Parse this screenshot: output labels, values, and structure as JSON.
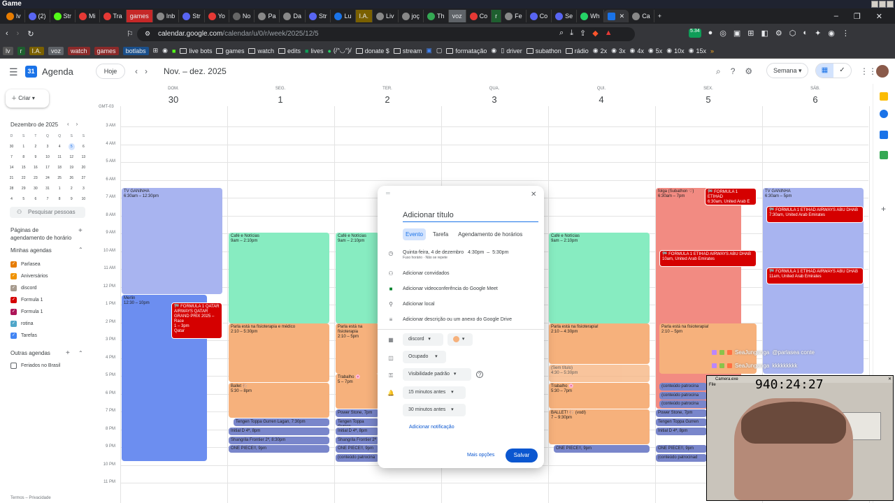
{
  "window": {
    "title": "Game"
  },
  "tabs": [
    "lv",
    "(2)",
    "Str",
    "Mi",
    "Tra",
    "games",
    "Inb",
    "Str",
    "Yo",
    "No",
    "Pa",
    "Da",
    "Str",
    "Lu",
    "I.A.",
    "Liv",
    "joç",
    "Th",
    "voz",
    "Co",
    "r",
    "Fe",
    "Co",
    "Se",
    "Wh",
    "",
    "Ca"
  ],
  "url": {
    "host": "calendar.google.com",
    "path": "/calendar/u/0/r/week/2025/12/5"
  },
  "extensions": {
    "badge": "5.34"
  },
  "bookmarks": [
    {
      "label": "lv",
      "chip": true
    },
    {
      "label": "r",
      "chip": true
    },
    {
      "label": "I.A.",
      "chip": true
    },
    {
      "label": "voz",
      "chip": true
    },
    {
      "label": "watch",
      "chip": true
    },
    {
      "label": "games",
      "chip": true
    },
    {
      "label": "botlabs",
      "chip": true
    },
    {
      "label": "live bots"
    },
    {
      "label": "games"
    },
    {
      "label": "watch"
    },
    {
      "label": "edits"
    },
    {
      "label": "lives"
    },
    {
      "label": "(/ᐢ◡ᐢ)/"
    },
    {
      "label": "donate $"
    },
    {
      "label": "stream"
    },
    {
      "label": "formatação"
    },
    {
      "label": "driver"
    },
    {
      "label": "subathon"
    },
    {
      "label": "rádio"
    },
    {
      "label": "2x"
    },
    {
      "label": "3x"
    },
    {
      "label": "4x"
    },
    {
      "label": "5x"
    },
    {
      "label": "10x"
    },
    {
      "label": "15x"
    }
  ],
  "header": {
    "app_name": "Agenda",
    "today": "Hoje",
    "range": "Nov. – dez. 2025",
    "view": "Semana",
    "logo_text": "31"
  },
  "sidebar": {
    "create": "Criar",
    "mini_month": "Dezembro de 2025",
    "weekdays": [
      "D",
      "S",
      "T",
      "Q",
      "Q",
      "S",
      "S"
    ],
    "weeks": [
      [
        "30",
        "1",
        "2",
        "3",
        "4",
        "5",
        "6"
      ],
      [
        "7",
        "8",
        "9",
        "10",
        "11",
        "12",
        "13"
      ],
      [
        "14",
        "15",
        "16",
        "17",
        "18",
        "19",
        "20"
      ],
      [
        "21",
        "22",
        "23",
        "24",
        "25",
        "26",
        "27"
      ],
      [
        "28",
        "29",
        "30",
        "31",
        "1",
        "2",
        "3"
      ],
      [
        "4",
        "5",
        "6",
        "7",
        "8",
        "9",
        "10"
      ]
    ],
    "search_people": "Pesquisar pessoas",
    "booking_pages": "Páginas de agendamento de horário",
    "my_calendars": "Minhas agendas",
    "calendars": [
      {
        "name": "Parlasea",
        "color": "#e67c00"
      },
      {
        "name": "Aniversários",
        "color": "#f09300"
      },
      {
        "name": "discord",
        "color": "#a79b8e"
      },
      {
        "name": "Formula 1",
        "color": "#d50000"
      },
      {
        "name": "Formula 1",
        "color": "#ad1457"
      },
      {
        "name": "rotina",
        "color": "#4fa6c9"
      },
      {
        "name": "Tarefas",
        "color": "#4285f4"
      }
    ],
    "other_calendars": "Outras agendas",
    "others": [
      {
        "name": "Feriados no Brasil"
      }
    ],
    "footer": "Termos – Privacidade"
  },
  "week": {
    "gmt": "GMT-03",
    "days": [
      {
        "name": "DOM.",
        "num": "30"
      },
      {
        "name": "SEG.",
        "num": "1"
      },
      {
        "name": "TER.",
        "num": "2"
      },
      {
        "name": "QUA.",
        "num": "3"
      },
      {
        "name": "QUI.",
        "num": "4"
      },
      {
        "name": "SEX.",
        "num": "5"
      },
      {
        "name": "SÁB.",
        "num": "6"
      }
    ],
    "hours": [
      "3 AM",
      "4 AM",
      "5 AM",
      "6 AM",
      "7 AM",
      "8 AM",
      "9 AM",
      "10 AM",
      "11 AM",
      "12 PM",
      "1 PM",
      "2 PM",
      "3 PM",
      "4 PM",
      "5 PM",
      "6 PM",
      "7 PM",
      "8 PM",
      "9 PM",
      "10 PM",
      "11 PM"
    ]
  },
  "events": {
    "e1": {
      "title": "TV GANINHA",
      "time": "6:30am – 12:30pm"
    },
    "e2": {
      "title": "Merlin",
      "time": "12:30 – 10pm"
    },
    "e3": {
      "title": "🏁 FORMULA 1 QATAR AIRWAYS QATAR GRAND PRIX 2025 – Race",
      "time": "1 – 3pm",
      "loc": "Qatar"
    },
    "e4": {
      "title": "Café e Notícias",
      "time": "9am – 2:10pm"
    },
    "e5": {
      "title": "Parla está na fisioterapia e médico",
      "time": "2:10 – 5:30pm"
    },
    "e6": {
      "title": "Ballet 🩰",
      "time": "5:30 – 8pm"
    },
    "e7": {
      "title": "Tengen Toppa Gurren Lagan, 7:30pm"
    },
    "e8": {
      "title": "Initial D 4ª, 8pm"
    },
    "e9": {
      "title": "Shangrila Frontier 2ª, 8:30pm"
    },
    "e10": {
      "title": "ONE PIECE!!, 9pm"
    },
    "e11": {
      "title": "Café e Notícias",
      "time": "9am – 2:10pm"
    },
    "e12": {
      "title": "Parla está na fisioterapia",
      "time": "2:10 – 5pm"
    },
    "e13": {
      "title": "Trabalho 🌸",
      "time": "5 – 7pm"
    },
    "e14": {
      "title": "Power Stone, 7pm"
    },
    "e15": {
      "title": "Tengen Toppa Gurren"
    },
    "e16": {
      "title": "Initial D 4ª, 8pm"
    },
    "e17": {
      "title": "Shangrila Frontier 2ª"
    },
    "e18": {
      "title": "ONE PIECE!!, 9pm"
    },
    "e19": {
      "title": "(conteúdo patrocina"
    },
    "e20": {
      "title": "Café e Notícias",
      "time": "9am – 2:10pm"
    },
    "e21": {
      "title": "Parla está na fisioterapia!",
      "time": "2:10 – 4:30pm"
    },
    "e22": {
      "title": "(Sem título)",
      "time": "4:30 – 5:30pm"
    },
    "e23": {
      "title": "Trabalho 🌸",
      "time": "5:30 – 7pm"
    },
    "e24": {
      "title": "BALLET! 🩰 (vodl)",
      "time": "7 – 9:30pm"
    },
    "e25": {
      "title": "ONE PIECE!!, 9pm"
    },
    "e26": {
      "title": "folga (Subathon ♡)",
      "time": "6:30am – 7pm"
    },
    "e27": {
      "title": "🏁 FORMULA 1 ETIHAD",
      "time": "6:30am, United Arab E"
    },
    "e28": {
      "title": "🏁 FORMULA 1 ETIHAD AIRWAYS ABU DHAB",
      "time": "10am, United Arab Emirates"
    },
    "e29": {
      "title": "Parla está na fisioterapia!",
      "time": "2:10 – 5pm"
    },
    "e30": {
      "title": "(conteúdo patrocina"
    },
    "e31": {
      "title": "(conteúdo patrocina"
    },
    "e32": {
      "title": "(conteúdo patrocina"
    },
    "e33": {
      "title": "Power Stone, 7pm"
    },
    "e34": {
      "title": "Tengen Toppa Gurren"
    },
    "e35": {
      "title": "Initial D 4ª, 8pm"
    },
    "e36": {
      "title": "ONE PIECE!!, 9pm"
    },
    "e37": {
      "title": "(conteúdo patrocinad"
    },
    "e38": {
      "title": "TV GANINHA",
      "time": "6:30am – 5pm"
    },
    "e39": {
      "title": "🏁 FORMULA 1 ETIHAD AIRWAYS ABU DHAB",
      "time": "7:30am, United Arab Emirates"
    },
    "e40": {
      "title": "🏁 FORMULA 1 ETIHAD AIRWAYS ABU DHAB",
      "time": "11am, United Arab Emirates"
    }
  },
  "dialog": {
    "title_placeholder": "Adicionar título",
    "tabs": [
      "Evento",
      "Tarefa",
      "Agendamento de horários"
    ],
    "date": "Quinta-feira, 4 de dezembro",
    "start": "4:30pm",
    "dash": "–",
    "end": "5:30pm",
    "tz": "Fuso horário · Não se repete",
    "guests": "Adicionar convidados",
    "meet": "Adicionar videoconferência do Google Meet",
    "location": "Adicionar local",
    "description": "Adicionar descrição ou um anexo do Google Drive",
    "calendar": "discord",
    "busy": "Ocupado",
    "visibility": "Visibilidade padrão",
    "notif1": "15 minutos antes",
    "notif2": "30 minutos antes",
    "add_notif": "Adicionar notificação",
    "more": "Mais opções",
    "save": "Salvar"
  },
  "overlay": {
    "webcam_title": "Camera.exe",
    "webcam_menu": "File",
    "timer": "940:24:27",
    "chat": [
      {
        "user": "SeaJunganga",
        "msg": "@parlasea conte"
      },
      {
        "user": "SeaJunganga",
        "msg": "kkkkkkkkk"
      }
    ]
  }
}
